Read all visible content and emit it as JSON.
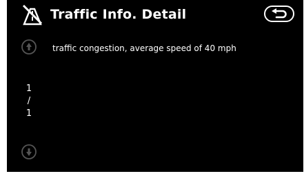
{
  "header": {
    "title": "Traffic Info. Detail",
    "icon": "traffic-road-icon",
    "back_icon": "return-arrow-icon"
  },
  "message": {
    "text": "traffic congestion, average speed of 40 mph"
  },
  "pager": {
    "current": "1",
    "separator": "/",
    "total": "1",
    "up_icon": "scroll-up-icon",
    "down_icon": "scroll-down-icon"
  },
  "colors": {
    "background": "#000000",
    "text": "#ffffff",
    "disabled": "#555555"
  }
}
